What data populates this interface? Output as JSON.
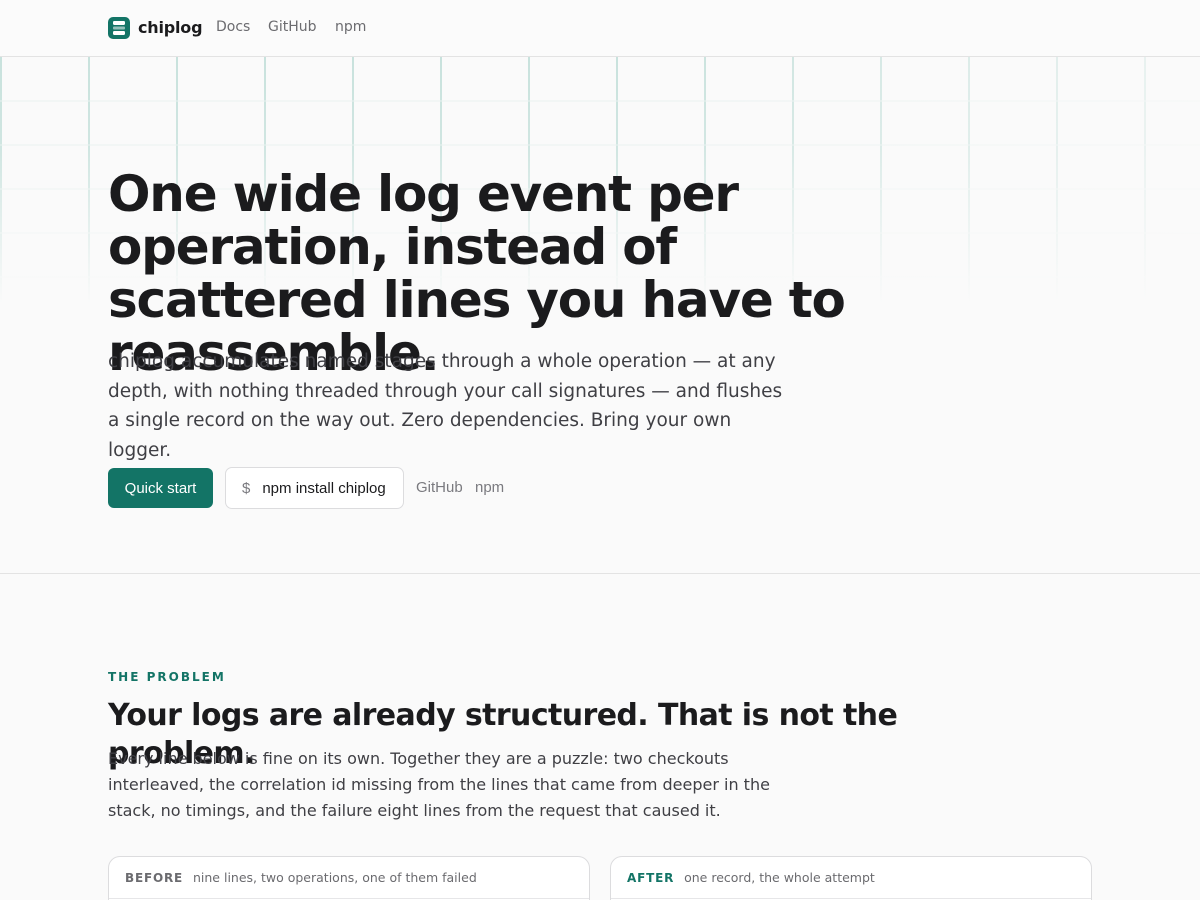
{
  "nav": {
    "brand": "chiplog",
    "links": [
      "Docs",
      "GitHub",
      "npm"
    ]
  },
  "hero": {
    "headline": "One wide log event per operation, instead of scattered lines you have to reassemble.",
    "lede": "chiplog accumulates named stages through a whole operation — at any depth, with nothing threaded through your call signatures — and flushes a single record on the way out. Zero dependencies. Bring your own logger.",
    "primary_button": "Quick start",
    "install_prompt": "$",
    "install_command": "npm install chiplog",
    "links": [
      "GitHub",
      "npm"
    ]
  },
  "problem": {
    "eyebrow": "THE PROBLEM",
    "title": "Your logs are already structured. That is not the problem.",
    "body": "Every line below is fine on its own. Together they are a puzzle: two checkouts interleaved, the correlation id missing from the lines that came from deeper in the stack, no timings, and the failure eight lines from the request that caused it.",
    "before": {
      "tag": "BEFORE",
      "caption": "nine lines, two operations, one of them failed"
    },
    "after": {
      "tag": "AFTER",
      "caption": "one record, the whole attempt"
    }
  },
  "colors": {
    "accent": "#137466",
    "text": "#1b1b1d",
    "muted": "#6b6b6f",
    "background": "#fafafa"
  },
  "icons": {
    "logo": "chiplog-logo-icon"
  }
}
